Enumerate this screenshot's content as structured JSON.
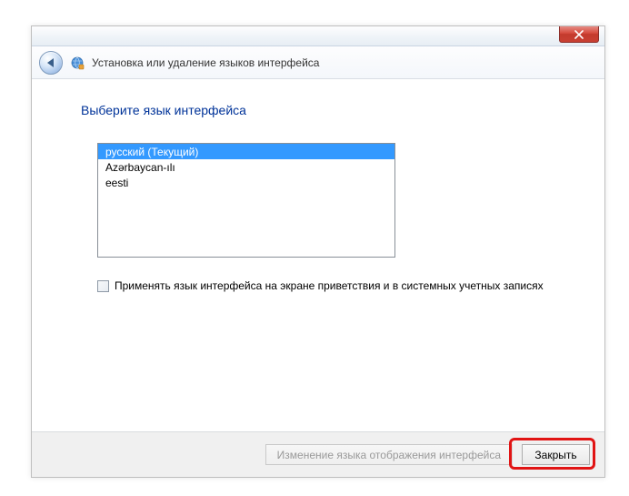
{
  "titlebar": {
    "window_title": "Установка или удаление языков интерфейса"
  },
  "content": {
    "heading": "Выберите язык интерфейса",
    "languages": [
      {
        "label": "русский (Текущий)",
        "selected": true
      },
      {
        "label": "Azərbaycan-ılı",
        "selected": false
      },
      {
        "label": "eesti",
        "selected": false
      }
    ],
    "checkbox_label": "Применять язык интерфейса на экране приветствия и в системных учетных записях",
    "checkbox_checked": false
  },
  "footer": {
    "change_label": "Изменение языка отображения интерфейса",
    "close_label": "Закрыть"
  }
}
